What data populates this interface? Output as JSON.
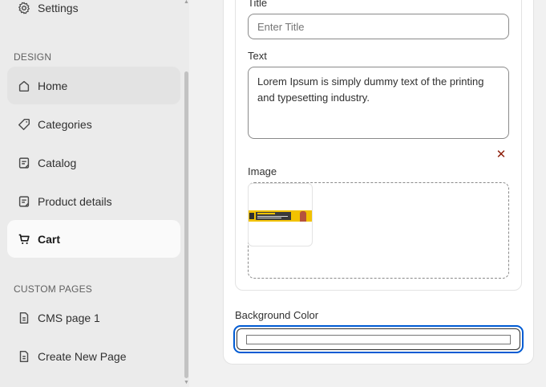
{
  "sidebar": {
    "settings_label": "Settings",
    "design_section": "DESIGN",
    "items": [
      {
        "label": "Home",
        "icon": "home-icon"
      },
      {
        "label": "Categories",
        "icon": "tag-icon"
      },
      {
        "label": "Catalog",
        "icon": "catalog-icon"
      },
      {
        "label": "Product details",
        "icon": "product-icon"
      },
      {
        "label": "Cart",
        "icon": "cart-icon"
      }
    ],
    "custom_section": "CUSTOM PAGES",
    "custom_items": [
      {
        "label": "CMS page 1",
        "icon": "page-icon"
      },
      {
        "label": "Create New Page",
        "icon": "page-icon"
      }
    ]
  },
  "form": {
    "title_label": "Title",
    "title_placeholder": "Enter Title",
    "text_label": "Text",
    "text_value": "Lorem Ipsum is simply dummy text of the printing and typesetting industry.",
    "remove_glyph": "✕",
    "image_label": "Image",
    "background_color_label": "Background Color",
    "background_color_value": "#ffffff"
  },
  "colors": {
    "focus": "#005bd3",
    "remove": "#8e1f0b",
    "active_nav": "#fafafa"
  }
}
